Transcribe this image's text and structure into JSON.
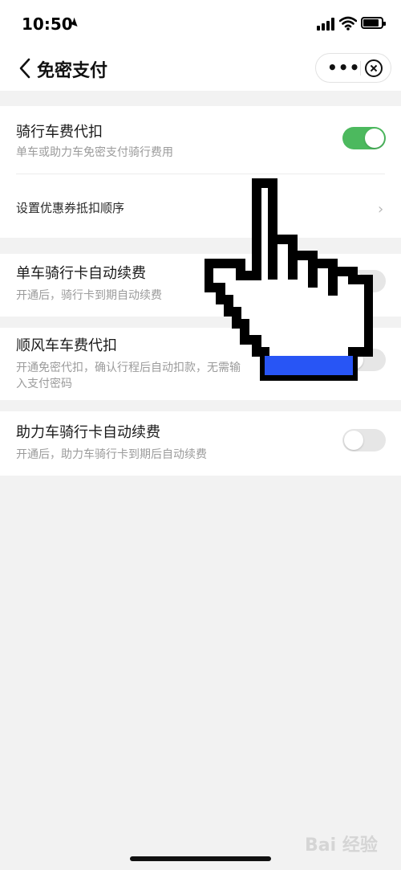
{
  "status_bar": {
    "time": "10:50",
    "icons": [
      "location-arrow-icon",
      "signal-icon",
      "wifi-icon",
      "battery-icon"
    ]
  },
  "nav": {
    "title": "免密支付",
    "back_icon": "chevron-left-icon",
    "more_icon": "•••",
    "close_icon": "close-icon"
  },
  "cards": [
    {
      "title": "骑行车费代扣",
      "description": "单车或助力车免密支付骑行费用",
      "toggle_on": true,
      "link_label": "设置优惠券抵扣顺序",
      "link_icon": "›"
    },
    {
      "title": "单车骑行卡自动续费",
      "description": "开通后，骑行卡到期自动续费",
      "toggle_on": false
    },
    {
      "title": "顺风车车费代扣",
      "description": "开通免密代扣，确认行程后自动扣款，无需输入支付密码",
      "toggle_on": false
    },
    {
      "title": "助力车骑行卡自动续费",
      "description": "开通后，助力车骑行卡到期后自动续费",
      "toggle_on": false
    }
  ],
  "colors": {
    "toggle_on": "#4cb95e",
    "toggle_off": "#e6e6e6",
    "page_bg": "#f2f2f2",
    "cursor_accent": "#2855f5"
  },
  "overlay": {
    "cursor_icon": "hand-cursor-icon"
  },
  "watermark": "Bai 经验"
}
